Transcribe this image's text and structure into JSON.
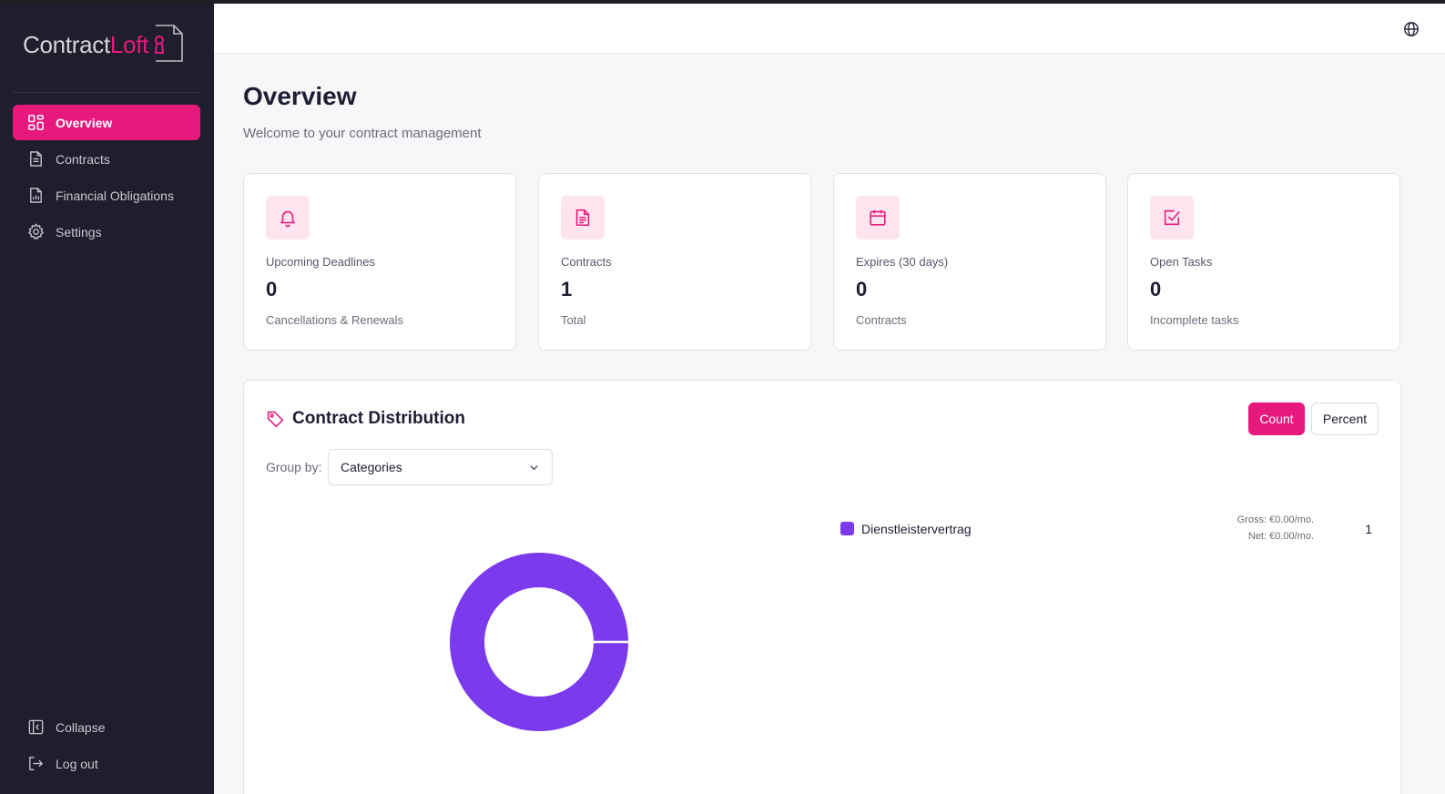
{
  "app": {
    "logo_part1": "Contract",
    "logo_part2": "Loft",
    "brand_color": "#e8197d",
    "sidebar_color": "#1e1e2d"
  },
  "sidebar": {
    "items": [
      {
        "label": "Overview",
        "icon": "grid-icon",
        "active": true
      },
      {
        "label": "Contracts",
        "icon": "document-icon"
      },
      {
        "label": "Financial Obligations",
        "icon": "report-chart-icon"
      },
      {
        "label": "Settings",
        "icon": "gear-icon"
      }
    ],
    "bottom": [
      {
        "label": "Collapse",
        "icon": "collapse-sidebar-icon"
      },
      {
        "label": "Log out",
        "icon": "logout-icon"
      }
    ]
  },
  "header": {
    "language_icon": "globe-icon"
  },
  "main": {
    "title": "Overview",
    "subtitle": "Welcome to your contract management"
  },
  "stats": [
    {
      "label": "Upcoming Deadlines",
      "value": "0",
      "desc": "Cancellations & Renewals",
      "icon": "bell-icon"
    },
    {
      "label": "Contracts",
      "value": "1",
      "desc": "Total",
      "icon": "document-icon"
    },
    {
      "label": "Expires (30 days)",
      "value": "0",
      "desc": "Contracts",
      "icon": "calendar-icon"
    },
    {
      "label": "Open Tasks",
      "value": "0",
      "desc": "Incomplete tasks",
      "icon": "checkbox-icon"
    }
  ],
  "distribution": {
    "title": "Contract Distribution",
    "title_icon": "tag-icon",
    "toggle": {
      "count": "Count",
      "percent": "Percent",
      "selected": "Count"
    },
    "group_by_label": "Group by:",
    "group_by_value": "Categories",
    "legend": [
      {
        "name": "Dienstleistervertrag",
        "gross": "Gross: €0.00/mo.",
        "net": "Net: €0.00/mo.",
        "count": "1",
        "color": "#7c3aed"
      }
    ],
    "chart_data": {
      "type": "pie",
      "categories": [
        "Dienstleistervertrag"
      ],
      "values": [
        1
      ],
      "colors": [
        "#7c3aed"
      ]
    }
  }
}
